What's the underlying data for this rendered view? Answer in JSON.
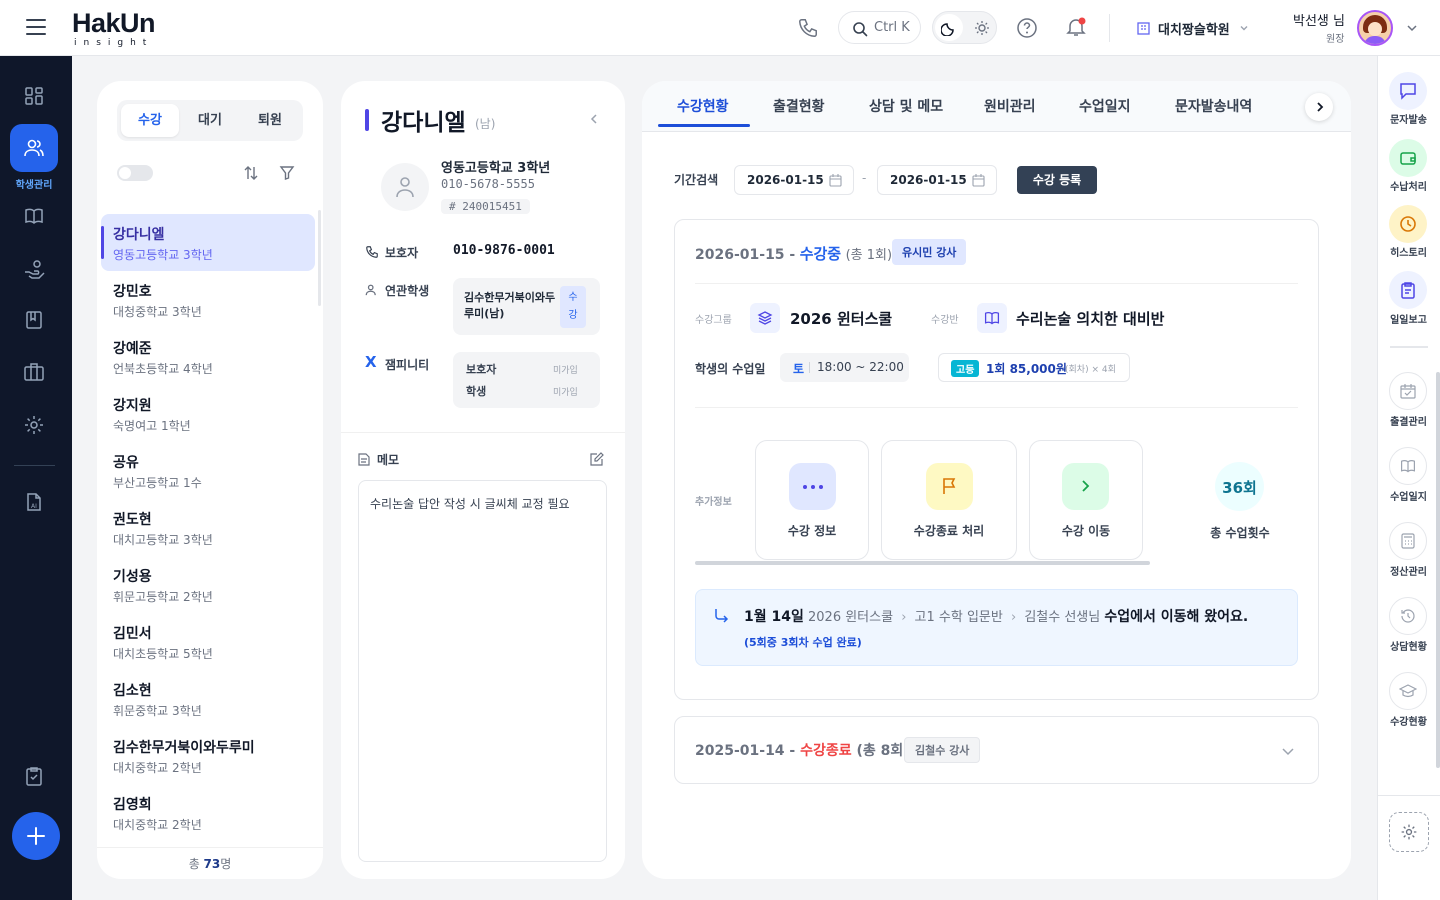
{
  "topbar": {
    "logo_main": "HakUn",
    "logo_sub": "insight",
    "search_label": "Ctrl K",
    "academy": "대치짱슬학원",
    "user_name": "박선생 님",
    "user_role": "원장"
  },
  "leftnav": {
    "active_label": "학생관리"
  },
  "student_list": {
    "tabs": [
      "수강",
      "대기",
      "퇴원"
    ],
    "items": [
      {
        "name": "강다니엘",
        "school": "영동고등학교 3학년"
      },
      {
        "name": "강민호",
        "school": "대청중학교 3학년"
      },
      {
        "name": "강예준",
        "school": "언북초등학교 4학년"
      },
      {
        "name": "강지원",
        "school": "숙명여고 1학년"
      },
      {
        "name": "공유",
        "school": "부산고등학교 1수"
      },
      {
        "name": "권도현",
        "school": "대치고등학교 3학년"
      },
      {
        "name": "기성용",
        "school": "휘문고등학교 2학년"
      },
      {
        "name": "김민서",
        "school": "대치초등학교 5학년"
      },
      {
        "name": "김소현",
        "school": "휘문중학교 3학년"
      },
      {
        "name": "김수한무거북이와두루미",
        "school": "대치중학교 2학년"
      },
      {
        "name": "김영희",
        "school": "대치중학교 2학년"
      }
    ],
    "total_prefix": "총 ",
    "total_count": "73",
    "total_suffix": "명"
  },
  "profile": {
    "name": "강다니엘",
    "gender": "(남)",
    "school": "영동고등학교 3학년",
    "phone": "010-5678-5555",
    "id": "# 240015451",
    "guardian_label": "보호자",
    "guardian_phone": "010-9876-0001",
    "related_label": "연관학생",
    "related_name": "김수한무거북이와두루미(남)",
    "related_badge_1": "수",
    "related_badge_2": "강",
    "jampi_label": "잼피니티",
    "jampi_rows": [
      {
        "label": "보호자",
        "status": "미가입"
      },
      {
        "label": "학생",
        "status": "미가입"
      }
    ],
    "memo_label": "메모",
    "memo_text": "수리논술 답안 작성 시 글씨체 교정 필요"
  },
  "tabs": [
    "수강현황",
    "출결현황",
    "상담 및 메모",
    "원비관리",
    "수업일지",
    "문자발송내역"
  ],
  "filter": {
    "label": "기간검색",
    "from": "2026-01-15",
    "to": "2026-01-15",
    "sep": "-",
    "register": "수강 등록"
  },
  "enroll1": {
    "date": "2026-01-15 -",
    "status": "수강중",
    "count": "(총 1회)",
    "teacher": "유시민 강사",
    "group_label": "수강그룹",
    "group": "2026 윈터스쿨",
    "class_label": "수강반",
    "class": "수리논술 의치한 대비반",
    "day_label": "학생의 수업일",
    "day": "토",
    "time": "18:00 ~ 22:00",
    "level": "고등",
    "fee": "1회 85,000원",
    "fee_note": "(회차) × 4회",
    "extra_label": "추가정보",
    "actions": [
      "수강 정보",
      "수강종료 처리",
      "수강 이동"
    ],
    "total_value": "36회",
    "total_label": "총 수업횟수",
    "move_date": "1월 14일",
    "move_group": "2026 윈터스쿨",
    "move_class": "고1 수학 입문반",
    "move_teacher": "김철수 선생님",
    "move_text": "수업에서 이동해 왔어요.",
    "move_note": "(5회중 3회차 수업 완료)"
  },
  "enroll2": {
    "date": "2025-01-14 -",
    "status": "수강종료",
    "count": "(총 8회)",
    "teacher": "김철수 강사"
  },
  "rightrail": [
    "문자발송",
    "수납처리",
    "히스토리",
    "일일보고",
    "출결관리",
    "수업일지",
    "정산관리",
    "상담현황",
    "수강현황"
  ],
  "colors": {
    "nav": "#0f172a",
    "accent": "#2563eb",
    "active_tab": "#1d4ed8",
    "status_active": "#2563eb",
    "status_end": "#ef4444"
  }
}
